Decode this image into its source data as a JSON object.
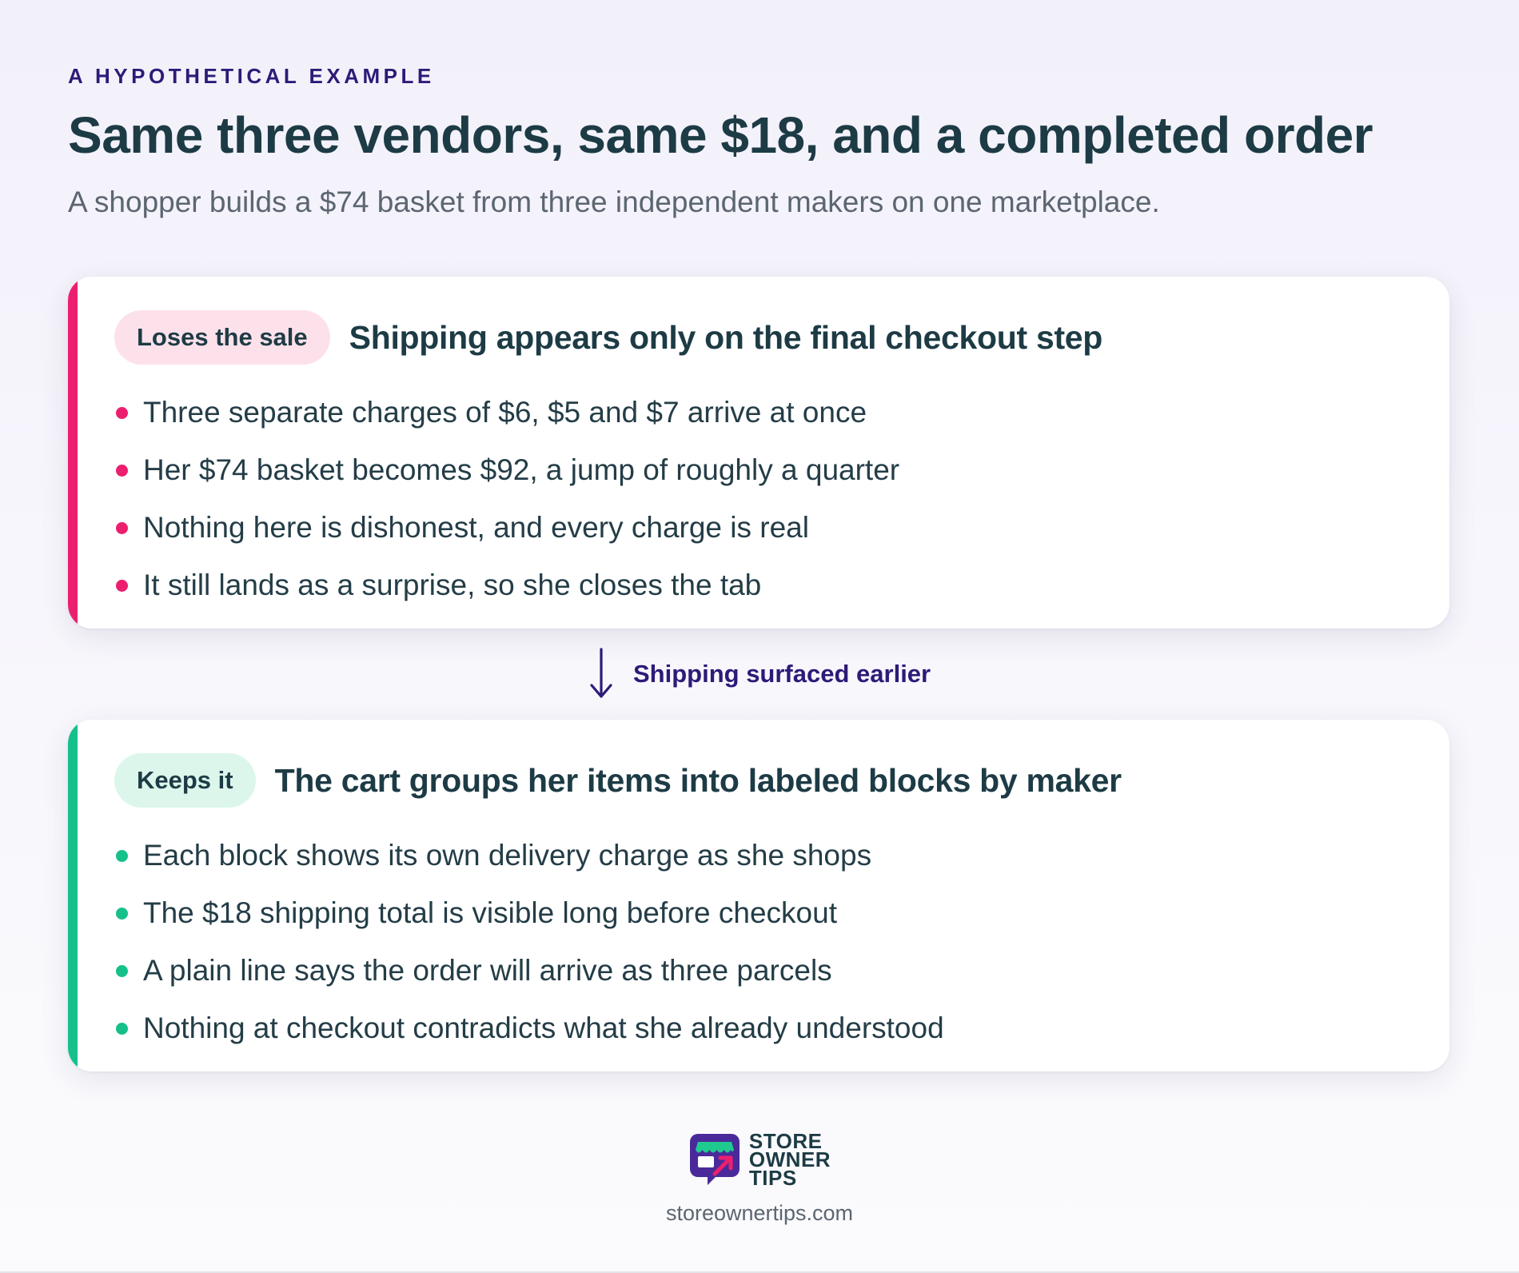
{
  "header": {
    "eyebrow": "A HYPOTHETICAL EXAMPLE",
    "title": "Same three vendors, same $18, and a completed order",
    "subtitle": "A shopper builds a $74 basket from three independent makers on one marketplace."
  },
  "cards": [
    {
      "badge": "Loses the sale",
      "title": "Shipping appears only on the final checkout step",
      "accent": "#ec1f6e",
      "bullets": [
        "Three separate charges of $6, $5 and $7 arrive at once",
        "Her $74 basket becomes $92, a jump of roughly a quarter",
        "Nothing here is dishonest, and every charge is real",
        "It still lands as a surprise, so she closes the tab"
      ]
    },
    {
      "badge": "Keeps it",
      "title": "The cart groups her items into labeled blocks by maker",
      "accent": "#16c08a",
      "bullets": [
        "Each block shows its own delivery charge as she shops",
        "The $18 shipping total is visible long before checkout",
        "A plain line says the order will arrive as three parcels",
        "Nothing at checkout contradicts what she already understood"
      ]
    }
  ],
  "connector": {
    "label": "Shipping surfaced earlier",
    "icon": "arrow-down-icon"
  },
  "brand": {
    "name_line1": "STORE",
    "name_line2": "OWNER",
    "name_line3": "TIPS",
    "url": "storeownertips.com",
    "icon": "storefront-logo-icon"
  },
  "colors": {
    "lose_accent": "#ec1f6e",
    "keep_accent": "#16c08a",
    "heading": "#1d3b45",
    "eyebrow": "#2e1a78",
    "logo_purple": "#4a2a9a",
    "logo_green": "#1fc98f",
    "logo_pink": "#ec1f6e"
  }
}
